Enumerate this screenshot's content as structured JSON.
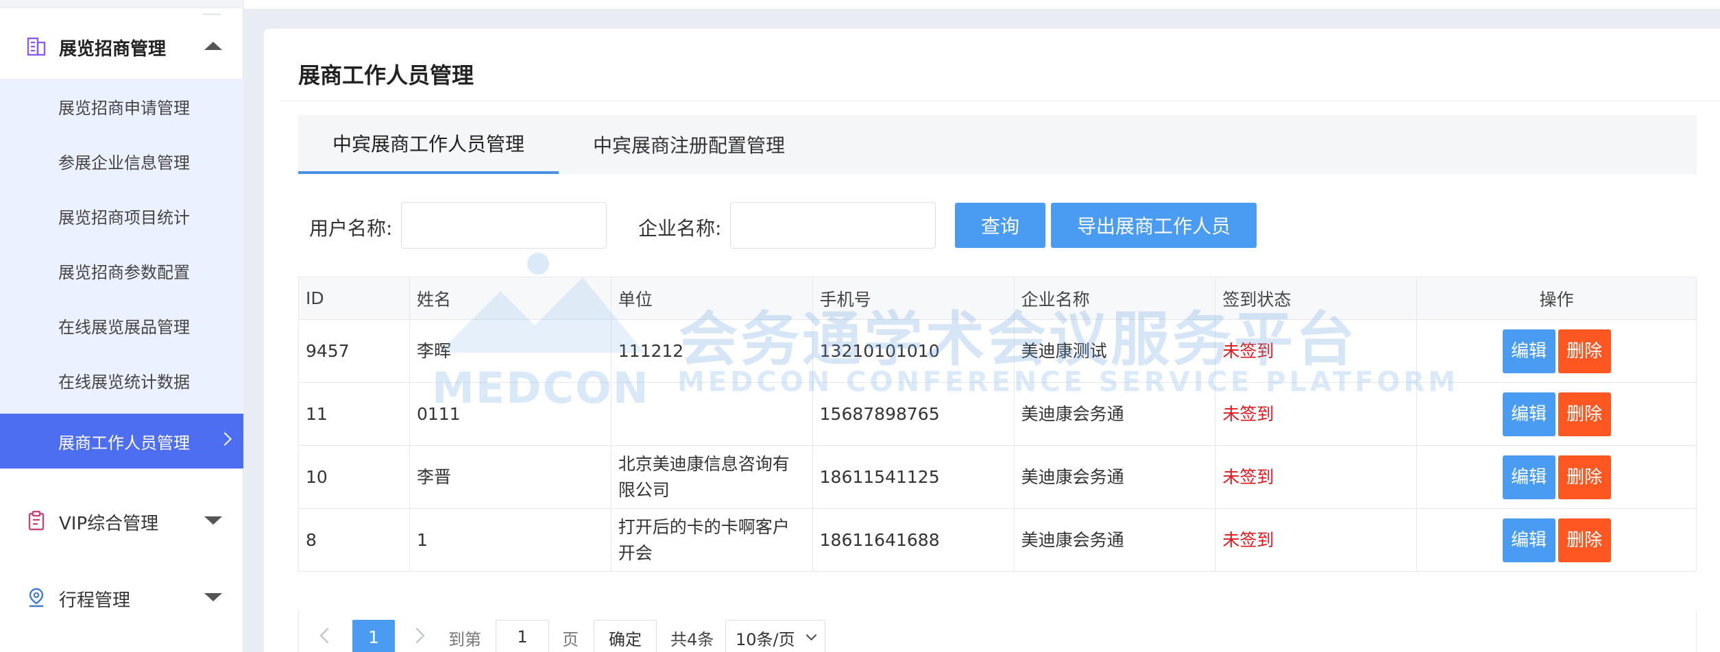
{
  "sidebar": {
    "groups": {
      "exhibition": {
        "label": "展览招商管理",
        "icon": "building-icon"
      },
      "vip": {
        "label": "VIP综合管理",
        "icon": "clipboard-icon"
      },
      "itinerary": {
        "label": "行程管理",
        "icon": "location-pin-icon"
      }
    },
    "items": [
      {
        "label": "展览招商申请管理"
      },
      {
        "label": "参展企业信息管理"
      },
      {
        "label": "展览招商项目统计"
      },
      {
        "label": "展览招商参数配置"
      },
      {
        "label": "在线展览展品管理"
      },
      {
        "label": "在线展览统计数据"
      },
      {
        "label": "展商工作人员管理"
      }
    ],
    "accent_color": "#4e6ef2"
  },
  "main": {
    "title": "展商工作人员管理",
    "tabs": [
      {
        "label": "中宾展商工作人员管理"
      },
      {
        "label": "中宾展商注册配置管理"
      }
    ],
    "filters": {
      "user_name_label": "用户名称:",
      "user_name_value": "",
      "company_name_label": "企业名称:",
      "company_name_value": "",
      "query_button": "查询",
      "export_button": "导出展商工作人员"
    },
    "table": {
      "headers": [
        "ID",
        "姓名",
        "单位",
        "手机号",
        "企业名称",
        "签到状态",
        "操作"
      ],
      "rows": [
        {
          "id": "9457",
          "name": "李晖",
          "unit": "111212",
          "phone": "13210101010",
          "company": "美迪康测试",
          "status": "未签到"
        },
        {
          "id": "11",
          "name": "0111",
          "unit": "",
          "phone": "15687898765",
          "company": "美迪康会务通",
          "status": "未签到"
        },
        {
          "id": "10",
          "name": "李晋",
          "unit": "北京美迪康信息咨询有限公司",
          "phone": "18611541125",
          "company": "美迪康会务通",
          "status": "未签到"
        },
        {
          "id": "8",
          "name": "1",
          "unit": "打开后的卡的卡啊客户开会",
          "phone": "18611641688",
          "company": "美迪康会务通",
          "status": "未签到"
        }
      ],
      "edit_label": "编辑",
      "delete_label": "删除",
      "status_color": "#e4161c",
      "edit_color": "#4a9cf2",
      "delete_color": "#ff5722"
    },
    "pagination": {
      "current_page": "1",
      "goto_label": "到第",
      "goto_value": "1",
      "page_suffix": "页",
      "confirm_label": "确定",
      "total_label": "共4条",
      "page_size": "10条/页"
    }
  },
  "watermark": {
    "cn": "会务通学术会议服务平台",
    "en": "MEDCON CONFERENCE SERVICE PLATFORM",
    "logo": "MEDCON"
  }
}
